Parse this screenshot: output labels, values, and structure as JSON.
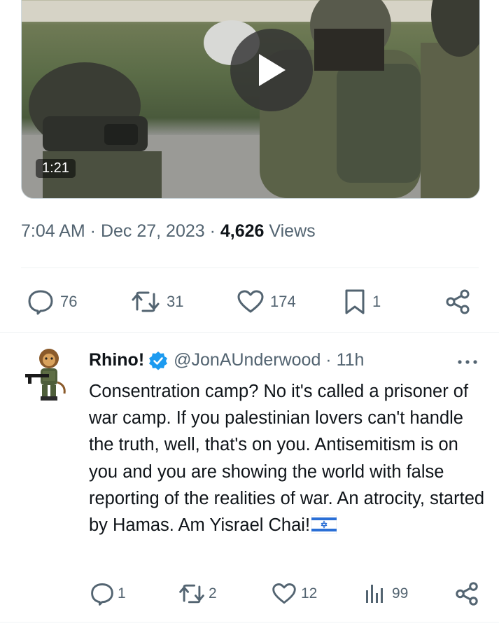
{
  "video": {
    "duration": "1:21"
  },
  "tweet": {
    "time": "7:04 AM",
    "sep1": " · ",
    "date": "Dec 27, 2023",
    "sep2": " · ",
    "views_count": "4,626",
    "views_label": " Views",
    "actions": {
      "replies": "76",
      "reposts": "31",
      "likes": "174",
      "bookmarks": "1"
    }
  },
  "reply": {
    "name": "Rhino!",
    "handle": "@JonAUnderwood · 11h",
    "text": "Consentration camp? No it's called a prisoner of war camp. If you palestinian lovers can't handle the truth, well, that's on you. Antisemitism is on you and you are showing the world with false reporting of the realities of war. An atrocity, started by Hamas. Am Yisrael Chai!",
    "actions": {
      "replies": "1",
      "reposts": "2",
      "likes": "12",
      "views": "99"
    }
  },
  "colors": {
    "text_primary": "#0f1419",
    "text_secondary": "#536471",
    "verified_blue": "#1d9bf0",
    "divider": "#eff3f4"
  },
  "icons": [
    "play-icon",
    "reply-icon",
    "repost-icon",
    "like-icon",
    "bookmark-icon",
    "share-icon",
    "verified-badge-icon",
    "more-icon",
    "views-icon",
    "israel-flag-icon"
  ]
}
